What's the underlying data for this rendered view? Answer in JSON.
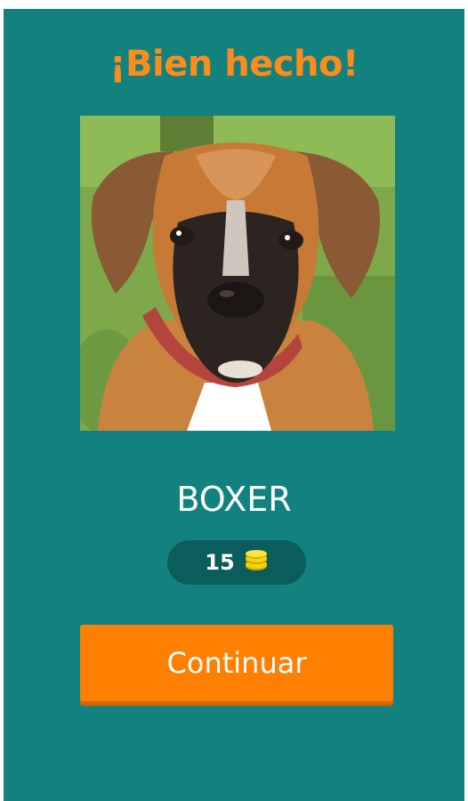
{
  "result": {
    "title": "¡Bien hecho!",
    "answer": "BOXER",
    "coins": "15",
    "continue_label": "Continuar"
  },
  "colors": {
    "background": "#13827f",
    "title": "#ff8c1a",
    "button": "#ff7f00",
    "pill": "#0b5d5b",
    "coin": "#f5d400"
  },
  "icons": {
    "coin": "coin-stack-icon"
  }
}
